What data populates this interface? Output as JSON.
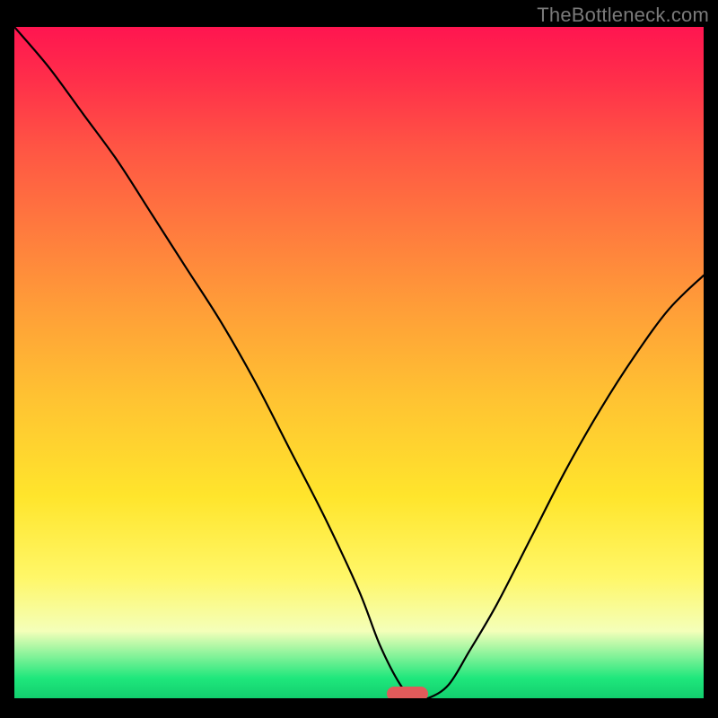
{
  "watermark": "TheBottleneck.com",
  "chart_data": {
    "type": "line",
    "title": "",
    "xlabel": "",
    "ylabel": "",
    "xlim": [
      0,
      100
    ],
    "ylim": [
      0,
      100
    ],
    "grid": false,
    "legend": false,
    "series": [
      {
        "name": "bottleneck-curve",
        "x": [
          0,
          5,
          10,
          15,
          20,
          25,
          30,
          35,
          40,
          45,
          50,
          53,
          56,
          58,
          60,
          63,
          66,
          70,
          75,
          80,
          85,
          90,
          95,
          100
        ],
        "values": [
          100,
          94,
          87,
          80,
          72,
          64,
          56,
          47,
          37,
          27,
          16,
          8,
          2,
          0,
          0,
          2,
          7,
          14,
          24,
          34,
          43,
          51,
          58,
          63
        ]
      }
    ],
    "marker": {
      "x": 57,
      "y": 0,
      "color": "#e15a5a"
    },
    "gradient_stops": [
      {
        "pos": 0,
        "color": "#ff1550"
      },
      {
        "pos": 8,
        "color": "#ff2f4a"
      },
      {
        "pos": 18,
        "color": "#ff5544"
      },
      {
        "pos": 30,
        "color": "#ff7a3e"
      },
      {
        "pos": 42,
        "color": "#ff9e38"
      },
      {
        "pos": 55,
        "color": "#ffc232"
      },
      {
        "pos": 70,
        "color": "#ffe52c"
      },
      {
        "pos": 82,
        "color": "#fff768"
      },
      {
        "pos": 90,
        "color": "#f4ffb9"
      },
      {
        "pos": 97,
        "color": "#1fe77c"
      },
      {
        "pos": 100,
        "color": "#12cf6e"
      }
    ]
  }
}
